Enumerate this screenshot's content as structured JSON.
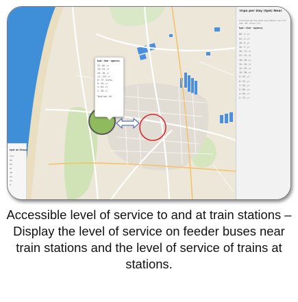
{
  "map": {
    "popup": {
      "header": "tpd : line - agency",
      "rows": [
        "22 : 80 - דן",
        "18 : 54 - דן",
        "16 : 16 - דן",
        "14 : 133 - דן",
        "8 : 73 - אפיקים",
        "6 : 19 - דן",
        "4 : 64 - דן",
        "2 : 36 - דן"
      ],
      "total": "Total tpd : 90"
    },
    "side_panel": {
      "title": "Trips per Day (tpd) Near",
      "description": "total trips per day (tpd) near station / לכל היום",
      "summary": "192 : 80 , ת.א. השלום",
      "subheader": "tpd : line - agency",
      "rows": [
        "80 : 1 - דן",
        "51 : 2 - דן",
        "40 : 5 - דן",
        "32 : 7 - דן",
        "30 : 11 - דן",
        "22 : 12 - דן",
        "18 : 16 - דן",
        "15 : 19 - דן",
        "12 : 25 - דן",
        "10 : 36 - דן",
        "9 : 42 - דן",
        "8 : 51 - דן",
        "7 : 54 - דן",
        "5 : 60 - דן",
        "4 : 64 - דן",
        "2 : 73 - דן"
      ]
    },
    "left_panel": {
      "title": "tpd at Stops",
      "rows": [
        "123",
        "89",
        "64",
        "51",
        "38",
        "22",
        "14",
        "9"
      ]
    }
  },
  "caption": "Accessible level of service to and at train stations – Display the level of service on feeder buses near train stations and the level of service of trains at stations."
}
